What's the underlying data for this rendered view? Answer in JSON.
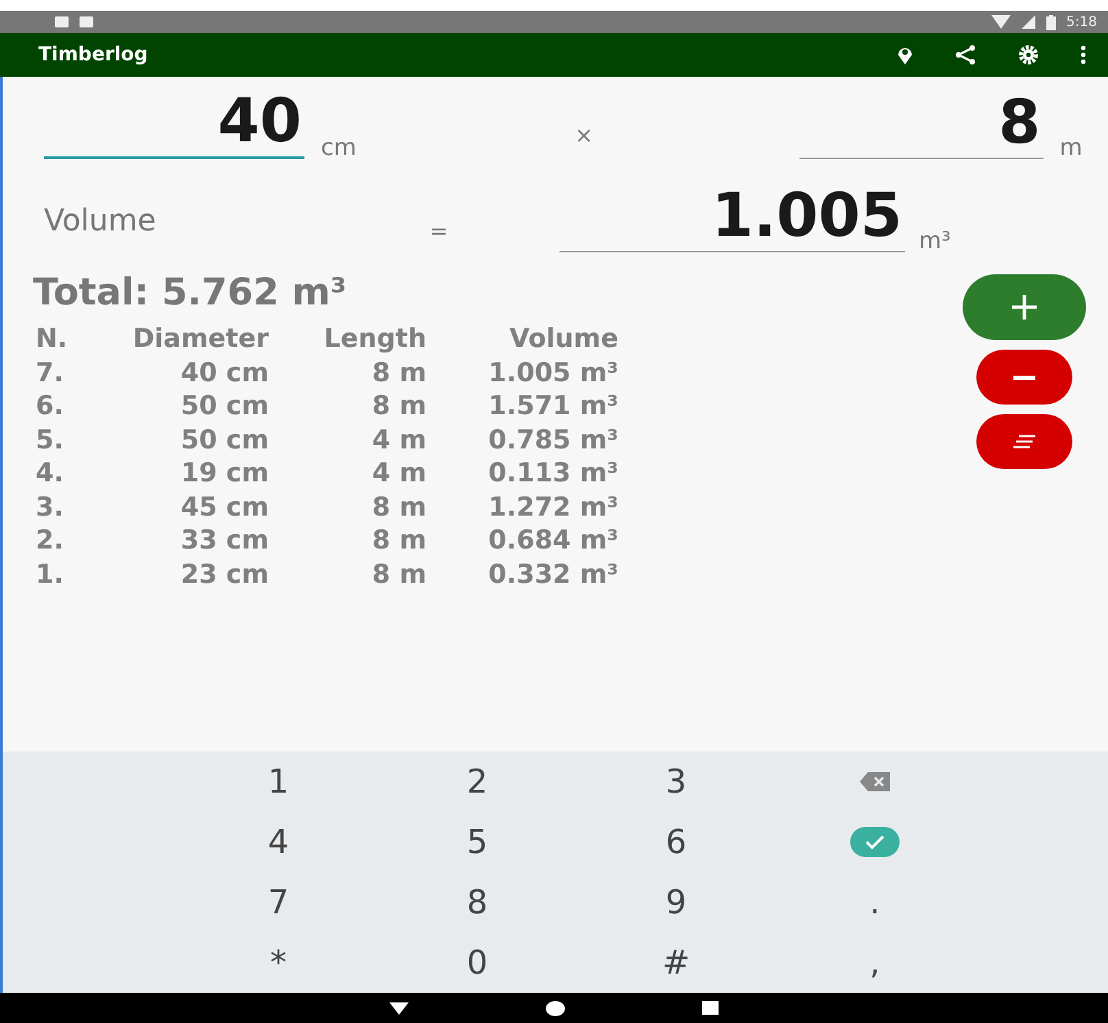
{
  "status_bar": {
    "time": "5:18"
  },
  "app_bar": {
    "title": "Timberlog"
  },
  "diameter_field": {
    "value": "40",
    "unit": "cm",
    "focused": true
  },
  "times_sign": "×",
  "length_field": {
    "value": "8",
    "unit": "m",
    "focused": false
  },
  "volume": {
    "label": "Volume",
    "equals": "=",
    "value": "1.005",
    "unit": "m³"
  },
  "total": "Total: 5.762 m³",
  "table": {
    "columns": [
      "N.",
      "Diameter",
      "Length",
      "Volume"
    ],
    "rows": [
      {
        "n": "7.",
        "diameter": "40 cm",
        "length": "8 m",
        "volume": "1.005 m³"
      },
      {
        "n": "6.",
        "diameter": "50 cm",
        "length": "8 m",
        "volume": "1.571 m³"
      },
      {
        "n": "5.",
        "diameter": "50 cm",
        "length": "4 m",
        "volume": "0.785 m³"
      },
      {
        "n": "4.",
        "diameter": "19 cm",
        "length": "4 m",
        "volume": "0.113 m³"
      },
      {
        "n": "3.",
        "diameter": "45 cm",
        "length": "8 m",
        "volume": "1.272 m³"
      },
      {
        "n": "2.",
        "diameter": "33 cm",
        "length": "8 m",
        "volume": "0.684 m³"
      },
      {
        "n": "1.",
        "diameter": "23 cm",
        "length": "8 m",
        "volume": "0.332 m³"
      }
    ]
  },
  "keypad": [
    {
      "kind": "text",
      "label": "1"
    },
    {
      "kind": "text",
      "label": "2"
    },
    {
      "kind": "text",
      "label": "3"
    },
    {
      "kind": "backspace"
    },
    {
      "kind": "text",
      "label": "4"
    },
    {
      "kind": "text",
      "label": "5"
    },
    {
      "kind": "text",
      "label": "6"
    },
    {
      "kind": "done"
    },
    {
      "kind": "text",
      "label": "7"
    },
    {
      "kind": "text",
      "label": "8"
    },
    {
      "kind": "text",
      "label": "9"
    },
    {
      "kind": "text",
      "label": "."
    },
    {
      "kind": "text",
      "label": "*"
    },
    {
      "kind": "text",
      "label": "0"
    },
    {
      "kind": "text",
      "label": "#"
    },
    {
      "kind": "text",
      "label": ","
    }
  ]
}
